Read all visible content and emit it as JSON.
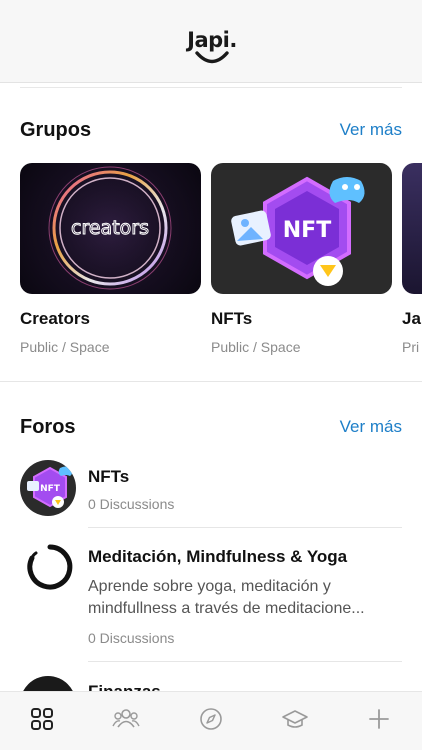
{
  "header": {
    "logo_text": "Japi."
  },
  "groups": {
    "title": "Grupos",
    "see_more": "Ver más",
    "items": [
      {
        "name": "Creators",
        "meta": "Public / Space",
        "thumb_text": "creators"
      },
      {
        "name": "NFTs",
        "meta": "Public / Space",
        "thumb_text": "NFT"
      },
      {
        "name": "Ja",
        "meta": "Pri",
        "thumb_text": ""
      }
    ]
  },
  "forums": {
    "title": "Foros",
    "see_more": "Ver más",
    "items": [
      {
        "title": "NFTs",
        "desc_lines": [],
        "count": "0 Discussions"
      },
      {
        "title": "Meditación, Mindfulness & Yoga",
        "desc_lines": [
          "Aprende sobre yoga, meditación y",
          "mindfullness a través de meditacione..."
        ],
        "count": "0 Discussions"
      },
      {
        "title": "Finanzas",
        "desc_lines": [],
        "count": ""
      }
    ]
  },
  "bottom_nav": {
    "items": [
      {
        "icon": "grid-icon",
        "active": true
      },
      {
        "icon": "users-icon",
        "active": false
      },
      {
        "icon": "compass-icon",
        "active": false
      },
      {
        "icon": "graduation-cap-icon",
        "active": false
      },
      {
        "icon": "plus-icon",
        "active": false
      }
    ]
  },
  "colors": {
    "accent": "#1e7fc8",
    "muted": "#8b8b8b",
    "nav_icon": "#9a9a9a"
  }
}
